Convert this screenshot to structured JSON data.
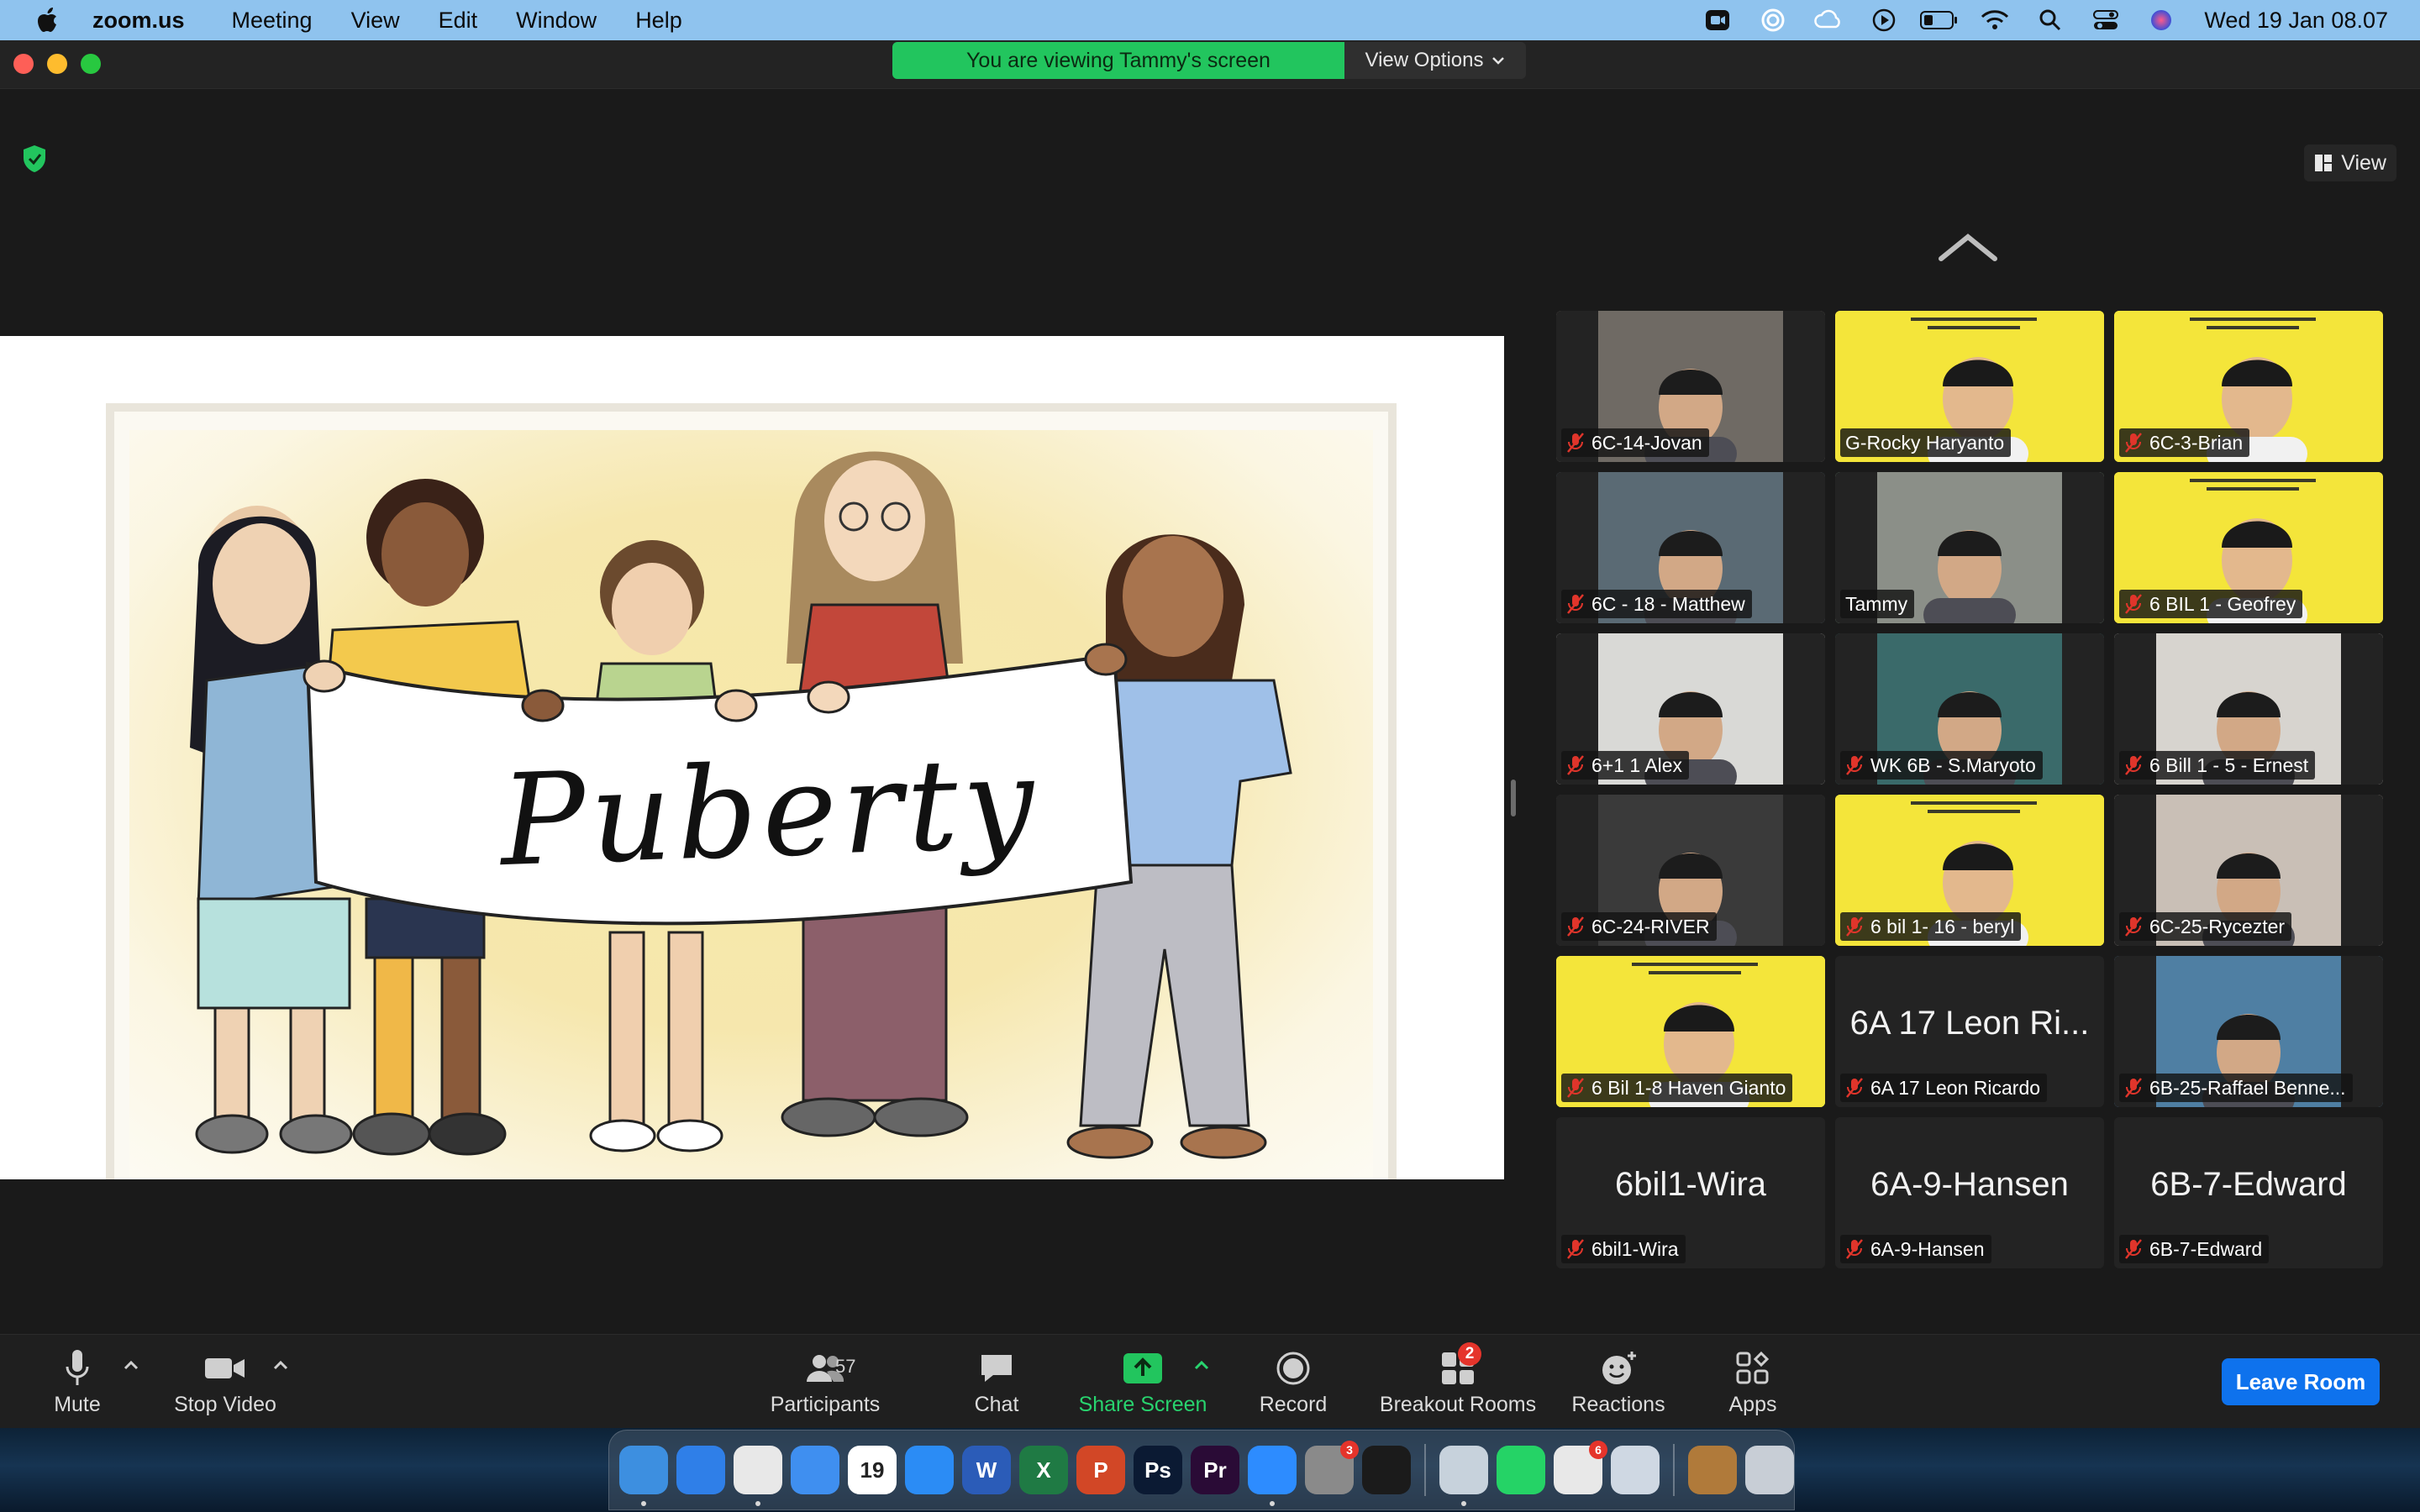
{
  "menubar": {
    "app_name": "zoom.us",
    "items": [
      "Meeting",
      "View",
      "Edit",
      "Window",
      "Help"
    ],
    "clock": "Wed 19 Jan  08.07",
    "status_icons": [
      "zoom-status-icon",
      "creative-cloud-icon",
      "icloud-icon",
      "play-icon",
      "battery-icon",
      "wifi-icon",
      "spotlight-search-icon",
      "control-center-icon",
      "siri-icon"
    ]
  },
  "window": {
    "banner_message": "You are viewing Tammy's screen",
    "view_options_label": "View Options",
    "view_button_label": "View"
  },
  "shared_screen": {
    "slide_title": "Puberty"
  },
  "gallery": {
    "tiles": [
      {
        "name": "6C-14-Jovan",
        "muted": true,
        "has_video": true,
        "bg": "#6f6a64",
        "yellow": false,
        "active": false,
        "big_name": ""
      },
      {
        "name": "G-Rocky Haryanto",
        "muted": false,
        "has_video": true,
        "bg": "#f4e53a",
        "yellow": true,
        "active": false,
        "big_name": ""
      },
      {
        "name": "6C-3-Brian",
        "muted": true,
        "has_video": true,
        "bg": "#f4e53a",
        "yellow": true,
        "active": false,
        "big_name": ""
      },
      {
        "name": "6C - 18 - Matthew",
        "muted": true,
        "has_video": true,
        "bg": "#5a6a74",
        "yellow": false,
        "active": false,
        "big_name": ""
      },
      {
        "name": "Tammy",
        "muted": false,
        "has_video": true,
        "bg": "#8b8f88",
        "yellow": false,
        "active": true,
        "big_name": ""
      },
      {
        "name": "6 BIL 1 - Geofrey",
        "muted": true,
        "has_video": true,
        "bg": "#f4e53a",
        "yellow": true,
        "active": false,
        "big_name": ""
      },
      {
        "name": "6+1  1 Alex",
        "muted": true,
        "has_video": true,
        "bg": "#d9d9d6",
        "yellow": false,
        "active": false,
        "big_name": ""
      },
      {
        "name": "WK 6B - S.Maryoto",
        "muted": true,
        "has_video": true,
        "bg": "#3a6a6a",
        "yellow": false,
        "active": false,
        "big_name": ""
      },
      {
        "name": "6 Bill 1 - 5 - Ernest",
        "muted": true,
        "has_video": true,
        "bg": "#d7d4cf",
        "yellow": false,
        "active": false,
        "big_name": ""
      },
      {
        "name": "6C-24-RIVER",
        "muted": true,
        "has_video": true,
        "bg": "#3a3a3a",
        "yellow": false,
        "active": false,
        "big_name": ""
      },
      {
        "name": "6 bil 1- 16 - beryl",
        "muted": true,
        "has_video": true,
        "bg": "#f4e53a",
        "yellow": true,
        "active": false,
        "big_name": ""
      },
      {
        "name": "6C-25-Rycezter",
        "muted": true,
        "has_video": true,
        "bg": "#c9bfb6",
        "yellow": false,
        "active": false,
        "big_name": ""
      },
      {
        "name": "6 Bil 1-8 Haven Gianto",
        "muted": true,
        "has_video": true,
        "bg": "#f4e53a",
        "yellow": true,
        "active": true,
        "big_name": ""
      },
      {
        "name": "6A 17 Leon Ricardo",
        "muted": true,
        "has_video": false,
        "bg": "#232323",
        "yellow": false,
        "active": false,
        "big_name": "6A 17 Leon Ri..."
      },
      {
        "name": "6B-25-Raffael Benne...",
        "muted": true,
        "has_video": true,
        "bg": "#4f7fa3",
        "yellow": false,
        "active": false,
        "big_name": ""
      },
      {
        "name": "6bil1-Wira",
        "muted": true,
        "has_video": false,
        "bg": "#232323",
        "yellow": false,
        "active": false,
        "big_name": "6bil1-Wira"
      },
      {
        "name": "6A-9-Hansen",
        "muted": true,
        "has_video": false,
        "bg": "#232323",
        "yellow": false,
        "active": false,
        "big_name": "6A-9-Hansen"
      },
      {
        "name": "6B-7-Edward",
        "muted": true,
        "has_video": false,
        "bg": "#232323",
        "yellow": false,
        "active": false,
        "big_name": "6B-7-Edward"
      }
    ]
  },
  "toolbar": {
    "mute_label": "Mute",
    "stop_video_label": "Stop Video",
    "participants_label": "Participants",
    "participants_count": "57",
    "chat_label": "Chat",
    "share_screen_label": "Share Screen",
    "record_label": "Record",
    "breakout_label": "Breakout Rooms",
    "breakout_badge": "2",
    "reactions_label": "Reactions",
    "apps_label": "Apps",
    "leave_label": "Leave Room"
  },
  "dock": {
    "apps": [
      {
        "name": "finder",
        "color": "#3d8fe0",
        "glyph": "",
        "running": true,
        "badge": ""
      },
      {
        "name": "safari",
        "color": "#2f7fe8",
        "glyph": "",
        "running": false,
        "badge": ""
      },
      {
        "name": "chrome",
        "color": "#e8e8e8",
        "glyph": "",
        "running": true,
        "badge": ""
      },
      {
        "name": "mail",
        "color": "#3f8ff0",
        "glyph": "",
        "running": false,
        "badge": ""
      },
      {
        "name": "calendar",
        "color": "#ffffff",
        "glyph": "19",
        "running": false,
        "badge": ""
      },
      {
        "name": "app-store",
        "color": "#2b8cf5",
        "glyph": "",
        "running": false,
        "badge": ""
      },
      {
        "name": "word",
        "color": "#2b5cb8",
        "glyph": "W",
        "running": false,
        "badge": ""
      },
      {
        "name": "excel",
        "color": "#1f7a44",
        "glyph": "X",
        "running": false,
        "badge": ""
      },
      {
        "name": "powerpoint",
        "color": "#d24726",
        "glyph": "P",
        "running": false,
        "badge": ""
      },
      {
        "name": "photoshop",
        "color": "#0b1a33",
        "glyph": "Ps",
        "running": false,
        "badge": ""
      },
      {
        "name": "premiere",
        "color": "#2a0b36",
        "glyph": "Pr",
        "running": false,
        "badge": ""
      },
      {
        "name": "zoom",
        "color": "#2d8cff",
        "glyph": "",
        "running": true,
        "badge": ""
      },
      {
        "name": "system-preferences",
        "color": "#8a8a8a",
        "glyph": "",
        "running": false,
        "badge": "3"
      },
      {
        "name": "activity-monitor",
        "color": "#1b1b1b",
        "glyph": "",
        "running": false,
        "badge": ""
      },
      {
        "name": "preview",
        "color": "#c7d2dc",
        "glyph": "",
        "running": true,
        "badge": ""
      },
      {
        "name": "whatsapp",
        "color": "#25d366",
        "glyph": "",
        "running": false,
        "badge": ""
      },
      {
        "name": "microsoft-office",
        "color": "#e8e8e8",
        "glyph": "",
        "running": false,
        "badge": "6"
      },
      {
        "name": "quicktime",
        "color": "#cfd8e3",
        "glyph": "",
        "running": false,
        "badge": ""
      },
      {
        "name": "downloads-stack",
        "color": "#b07a3a",
        "glyph": "",
        "running": false,
        "badge": ""
      },
      {
        "name": "trash",
        "color": "#c8ced6",
        "glyph": "",
        "running": false,
        "badge": ""
      }
    ]
  }
}
